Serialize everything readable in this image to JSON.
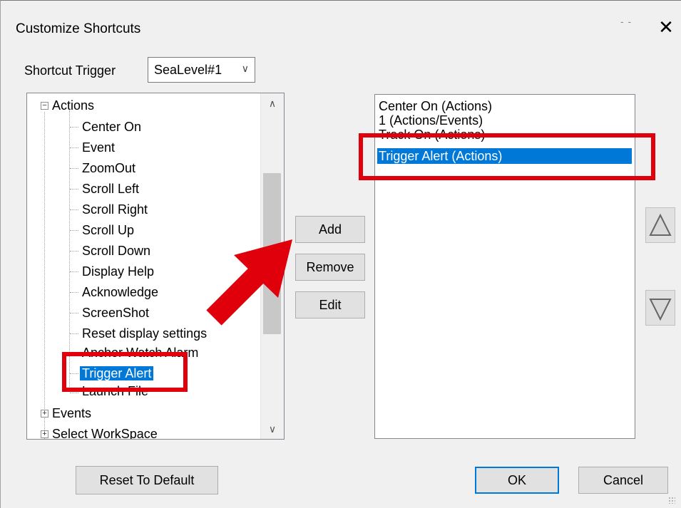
{
  "dialog": {
    "title": "Customize Shortcuts",
    "close_glyph": "✕",
    "title_dots": "- -"
  },
  "trigger": {
    "label": "Shortcut Trigger",
    "value": "SeaLevel#1"
  },
  "tree": {
    "root": {
      "label": "Actions",
      "expander": "−"
    },
    "children": [
      "Center On",
      "Event",
      "ZoomOut",
      "Scroll Left",
      "Scroll Right",
      "Scroll Up",
      "Scroll Down",
      "Display Help",
      "Acknowledge",
      "ScreenShot",
      "Reset display settings",
      "Anchor Watch Alarm",
      "Trigger Alert",
      "Launch File"
    ],
    "selected": "Trigger Alert",
    "siblings": [
      {
        "label": "Events",
        "expander": "+"
      },
      {
        "label": "Select WorkSpace",
        "expander": "+"
      }
    ]
  },
  "buttons": {
    "add": "Add",
    "remove": "Remove",
    "edit": "Edit",
    "reset": "Reset To Default",
    "ok": "OK",
    "cancel": "Cancel"
  },
  "assigned": {
    "items": [
      "Center On (Actions)",
      "1 (Actions/Events)",
      "Track On (Actions)",
      "Trigger Alert (Actions)"
    ],
    "selected": "Trigger Alert (Actions)"
  },
  "move": {
    "up": "move-up",
    "down": "move-down"
  },
  "colors": {
    "selection": "#0078d7",
    "annotation": "#e0000b"
  }
}
